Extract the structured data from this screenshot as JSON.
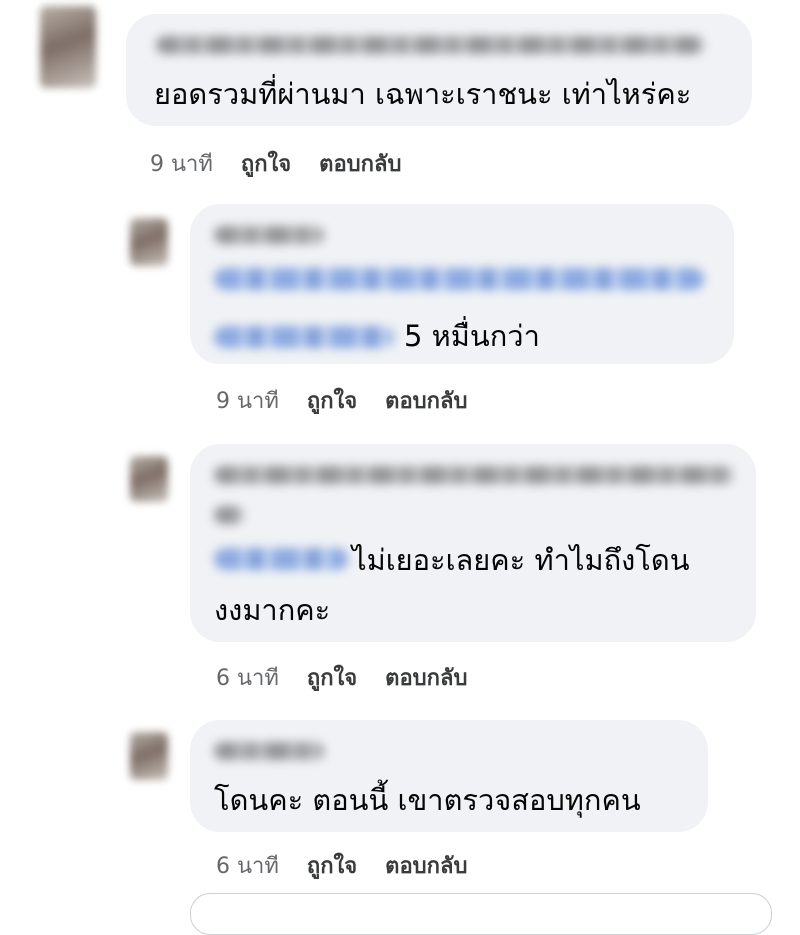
{
  "comments": [
    {
      "text": "ยอดรวมที่ผ่านมา เฉพาะเราชนะ เท่าไหร่คะ",
      "time": "9 นาที",
      "like": "ถูกใจ",
      "reply": "ตอบกลับ"
    },
    {
      "text": "5 หมื่นกว่า",
      "time": "9 นาที",
      "like": "ถูกใจ",
      "reply": "ตอบกลับ"
    },
    {
      "text_line1": "ไม่เยอะเลยคะ ทำไมถึงโดน",
      "text_line2": "งงมากคะ",
      "time": "6 นาที",
      "like": "ถูกใจ",
      "reply": "ตอบกลับ"
    },
    {
      "text": "โดนคะ ตอนนี้ เขาตรวจสอบทุกคน",
      "time": "6 นาที",
      "like": "ถูกใจ",
      "reply": "ตอบกลับ"
    }
  ],
  "colors": {
    "bubble": "#f0f2f5",
    "text": "#050505",
    "meta": "#65676b",
    "mention": "#2d5fc4"
  }
}
